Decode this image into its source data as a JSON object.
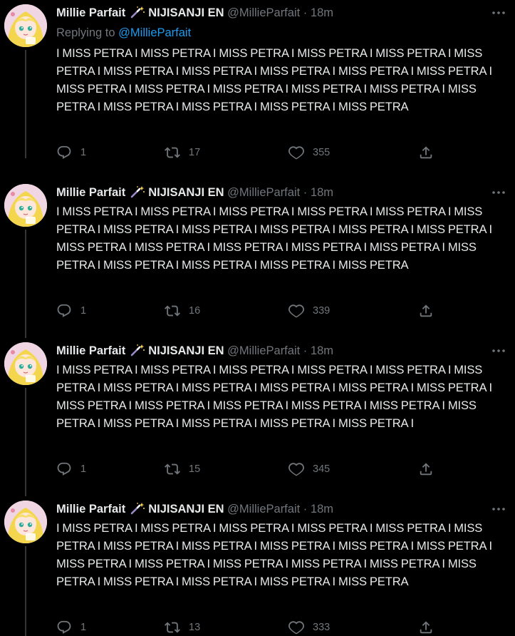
{
  "colors": {
    "background": "#000000",
    "text": "#e7e9ea",
    "muted": "#71767b",
    "link": "#1d9bf0",
    "thread_line": "#333639"
  },
  "tweets": [
    {
      "display_name": "Millie Parfait",
      "badge_icon": "magic-wand-icon",
      "affiliation": "NIJISANJI EN",
      "handle": "@MillieParfait",
      "separator": "·",
      "time": "18m",
      "reply_prefix": "Replying to",
      "reply_handle": "@MillieParfait",
      "text": "I MISS PETRA I MISS PETRA I MISS PETRA I MISS PETRA I MISS PETRA I MISS PETRA I MISS PETRA I MISS PETRA I MISS PETRA I MISS PETRA I MISS PETRA I MISS PETRA I MISS PETRA I MISS PETRA I MISS PETRA I MISS PETRA I MISS PETRA I MISS PETRA I MISS PETRA I MISS PETRA I MISS PETRA",
      "reply_count": "1",
      "retweet_count": "17",
      "like_count": "355"
    },
    {
      "display_name": "Millie Parfait",
      "badge_icon": "magic-wand-icon",
      "affiliation": "NIJISANJI EN",
      "handle": "@MillieParfait",
      "separator": "·",
      "time": "18m",
      "text": "I MISS PETRA I MISS PETRA I MISS PETRA I MISS PETRA I MISS PETRA I MISS PETRA I MISS PETRA I MISS PETRA I MISS PETRA I MISS PETRA I MISS PETRA I MISS PETRA I MISS PETRA I MISS PETRA I MISS PETRA I MISS PETRA I MISS PETRA I MISS PETRA I MISS PETRA I MISS PETRA I MISS PETRA",
      "reply_count": "1",
      "retweet_count": "16",
      "like_count": "339"
    },
    {
      "display_name": "Millie Parfait",
      "badge_icon": "magic-wand-icon",
      "affiliation": "NIJISANJI EN",
      "handle": "@MillieParfait",
      "separator": "·",
      "time": "18m",
      "text": "I MISS PETRA I MISS PETRA I MISS PETRA I MISS PETRA I MISS PETRA I MISS PETRA I MISS PETRA I MISS PETRA I MISS PETRA I MISS PETRA I MISS PETRA I MISS PETRA I MISS PETRA I MISS PETRA I MISS PETRA I MISS PETRA I MISS PETRA I MISS PETRA I MISS PETRA I MISS PETRA I MISS PETRA I",
      "reply_count": "1",
      "retweet_count": "15",
      "like_count": "345"
    },
    {
      "display_name": "Millie Parfait",
      "badge_icon": "magic-wand-icon",
      "affiliation": "NIJISANJI EN",
      "handle": "@MillieParfait",
      "separator": "·",
      "time": "18m",
      "text": "I MISS PETRA I MISS PETRA I MISS PETRA I MISS PETRA I MISS PETRA I MISS PETRA I MISS PETRA I MISS PETRA I MISS PETRA I MISS PETRA I MISS PETRA I MISS PETRA I MISS PETRA I MISS PETRA I MISS PETRA I MISS PETRA I MISS PETRA I MISS PETRA I MISS PETRA I MISS PETRA I MISS PETRA",
      "reply_count": "1",
      "retweet_count": "13",
      "like_count": "333"
    }
  ]
}
